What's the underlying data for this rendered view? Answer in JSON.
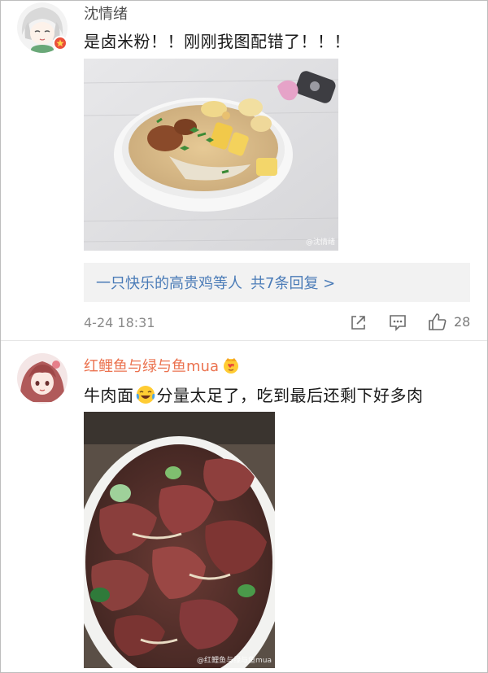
{
  "comments": [
    {
      "username": "沈情绪",
      "text": "是卤米粉！！刚刚我图配错了！！！",
      "photo_watermark": "@沈情绪",
      "replies": {
        "label": "一只快乐的高贵鸡等人",
        "count_label": "共7条回复 >"
      },
      "time": "4-24 18:31",
      "likes": "28",
      "icons": [
        "share-icon",
        "comment-icon",
        "like-icon"
      ]
    },
    {
      "username": "红鲤鱼与绿与鱼mua",
      "badge_icon": "crown-heart-emoji",
      "text_before": "牛肉面",
      "emoji": "laughing-tears-emoji",
      "text_after": "分量太足了，吃到最后还剩下好多肉",
      "photo_watermark": "@红鲤鱼与绿与鱼mua"
    }
  ],
  "colors": {
    "username_gray": "#4f4f4f",
    "username_orange": "#eb7350",
    "link_blue": "#4a7bb7",
    "meta_gray": "#8a8a8a"
  }
}
